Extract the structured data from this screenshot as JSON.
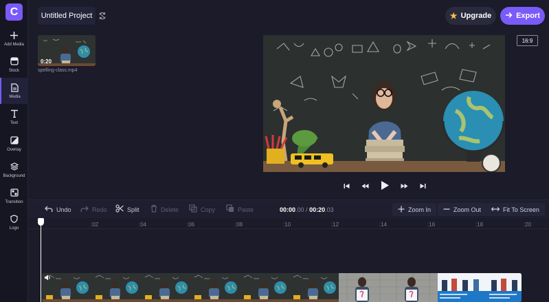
{
  "app": {
    "logo_letter": "C",
    "accent": "#7a5af8"
  },
  "sidebar": {
    "items": [
      {
        "label": "Add Media",
        "icon": "plus-icon"
      },
      {
        "label": "Stock",
        "icon": "stock-icon"
      },
      {
        "label": "Media",
        "icon": "document-icon",
        "active": true
      },
      {
        "label": "Text",
        "icon": "text-icon"
      },
      {
        "label": "Overlay",
        "icon": "overlay-icon"
      },
      {
        "label": "Background",
        "icon": "layers-icon"
      },
      {
        "label": "Transition",
        "icon": "transition-icon"
      },
      {
        "label": "Logo",
        "icon": "shield-icon"
      }
    ]
  },
  "header": {
    "project_title": "Untitled Project",
    "upgrade_label": "Upgrade",
    "export_label": "Export"
  },
  "media": {
    "duration": "0:20",
    "filename": "spelling-class.mp4"
  },
  "preview": {
    "aspect_ratio": "16:9"
  },
  "timeline": {
    "toolbar": {
      "undo": "Undo",
      "redo": "Redo",
      "split": "Split",
      "delete": "Delete",
      "copy": "Copy",
      "paste": "Paste"
    },
    "timecode": {
      "current": "00:00",
      "current_frac": ".00",
      "separator": " / ",
      "total": "00:20",
      "total_frac": ".03"
    },
    "zoom_in": "Zoom In",
    "zoom_out": "Zoom Out",
    "fit": "Fit To Screen",
    "ruler": [
      ":02",
      ":04",
      ":06",
      ":08",
      ":10",
      ":12",
      ":14",
      ":16",
      ":18",
      ":20"
    ]
  }
}
